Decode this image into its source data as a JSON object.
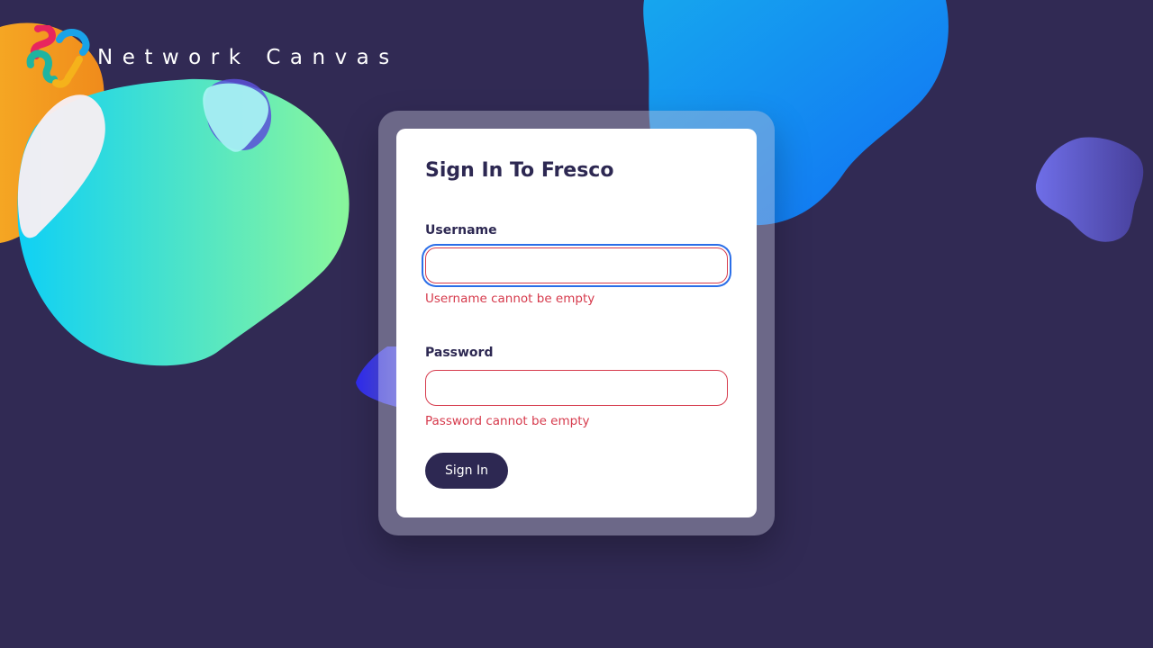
{
  "brand": {
    "title": "Network Canvas",
    "logo_icon": "network-canvas-logo-icon"
  },
  "login": {
    "title": "Sign In To Fresco",
    "username": {
      "label": "Username",
      "value": "",
      "error": "Username cannot be empty",
      "focused": true
    },
    "password": {
      "label": "Password",
      "value": "",
      "error": "Password cannot be empty"
    },
    "submit_label": "Sign In"
  },
  "colors": {
    "background": "#312a54",
    "panel": "#ffffff",
    "text_primary": "#2d2852",
    "error": "#d63a4c",
    "focus_ring": "#2a6ee8",
    "button": "#2d2852"
  }
}
